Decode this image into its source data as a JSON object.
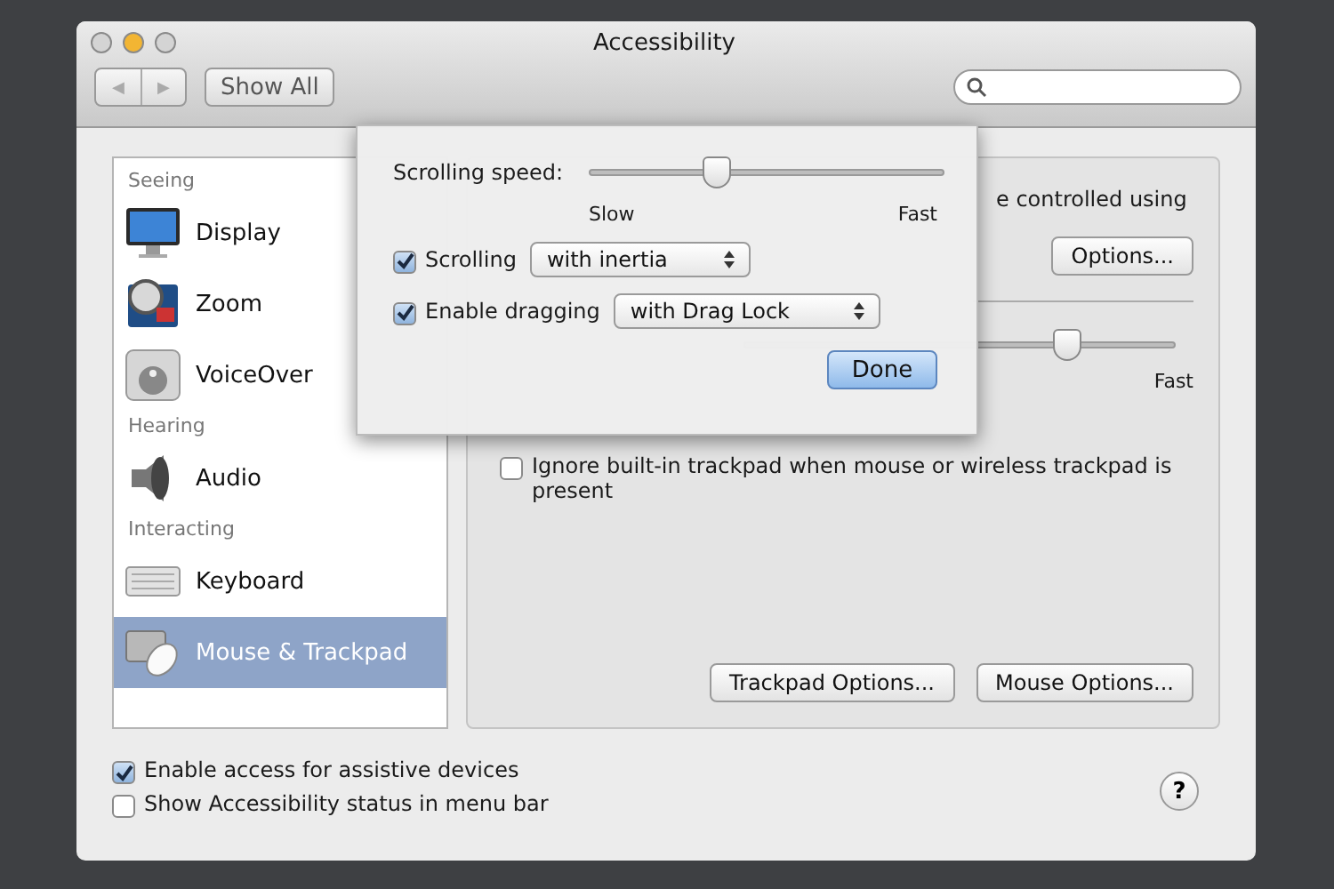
{
  "window": {
    "title": "Accessibility"
  },
  "toolbar": {
    "back_label": "◀",
    "forward_label": "▶",
    "show_all": "Show All"
  },
  "sidebar": {
    "items": [
      {
        "kind": "header",
        "label": "Seeing"
      },
      {
        "kind": "item",
        "label": "Display",
        "selected": false
      },
      {
        "kind": "item",
        "label": "Zoom",
        "selected": false
      },
      {
        "kind": "item",
        "label": "VoiceOver",
        "selected": false
      },
      {
        "kind": "header",
        "label": "Hearing"
      },
      {
        "kind": "item",
        "label": "Audio",
        "selected": false
      },
      {
        "kind": "header",
        "label": "Interacting"
      },
      {
        "kind": "item",
        "label": "Keyboard",
        "selected": false
      },
      {
        "kind": "item",
        "label": "Mouse & Trackpad",
        "selected": true
      }
    ]
  },
  "panel": {
    "description_fragment": "e controlled using",
    "options_button": "Options...",
    "double_click_slider": {
      "level": 0.75,
      "max_label": "Fast"
    },
    "ignore_trackpad": {
      "label": "Ignore built-in trackpad when mouse or wireless trackpad is present",
      "checked": false
    },
    "buttons": [
      "Trackpad Options...",
      "Mouse Options..."
    ]
  },
  "popover": {
    "speed_label": "Scrolling speed:",
    "speed_slider": {
      "level": 0.36,
      "min_label": "Slow",
      "max_label": "Fast"
    },
    "options": [
      {
        "label": "Scrolling",
        "checked": true,
        "value": "with inertia"
      },
      {
        "label": "Enable dragging",
        "checked": true,
        "value": "with Drag Lock"
      }
    ],
    "done_button": "Done"
  },
  "footer": {
    "checkboxes": [
      {
        "label": "Enable access for assistive devices",
        "checked": true
      },
      {
        "label": "Show Accessibility status in menu bar",
        "checked": false
      }
    ],
    "help": "?"
  }
}
